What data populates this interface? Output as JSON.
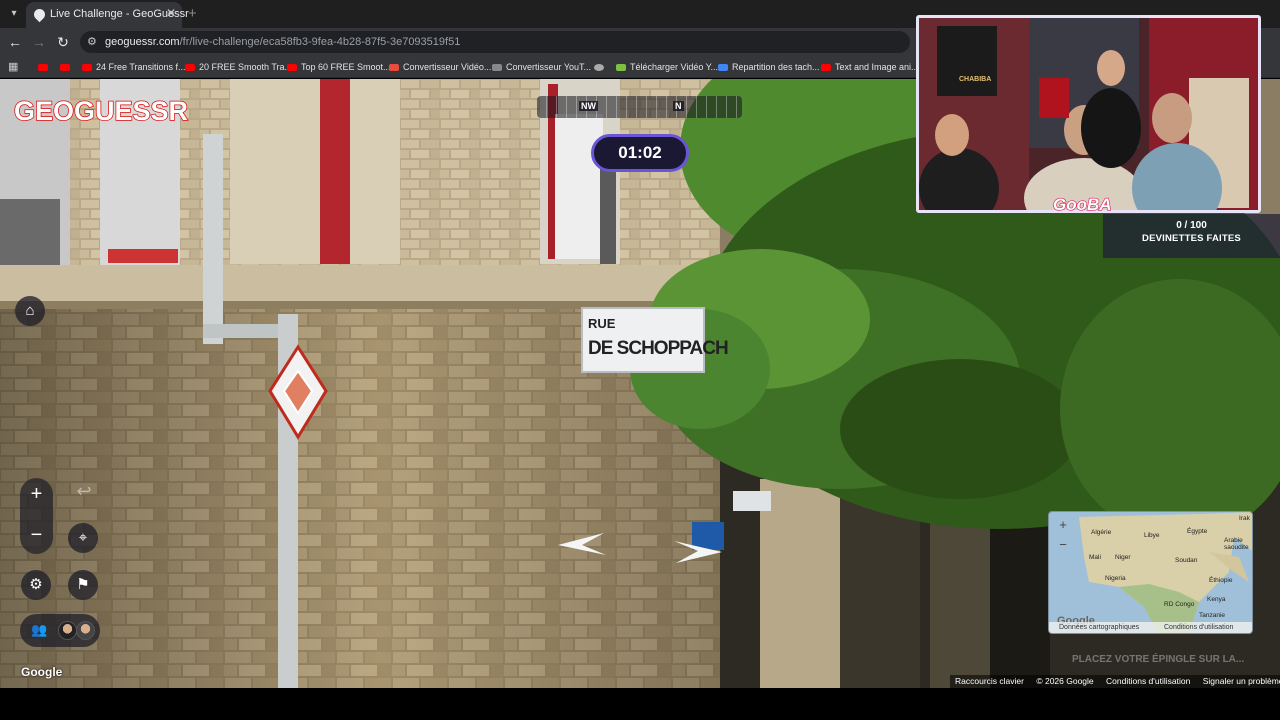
{
  "browser": {
    "tab_title": "Live Challenge - GeoGuessr",
    "url_domain": "geoguessr.com",
    "url_path": "/fr/live-challenge/eca58fb3-9fea-4b28-87f5-3e7093519f51",
    "bookmarks": [
      {
        "label": "",
        "color": "#ff0000"
      },
      {
        "label": "",
        "color": "#ff0000"
      },
      {
        "label": "24 Free Transitions f...",
        "color": "#ff0000"
      },
      {
        "label": "20 FREE Smooth Tra...",
        "color": "#ff0000"
      },
      {
        "label": "Top 60 FREE Smoot...",
        "color": "#ff0000"
      },
      {
        "label": "Convertisseur Vidéo...",
        "color": "#e74c3c"
      },
      {
        "label": "Convertisseur YouT...",
        "color": "#888888"
      },
      {
        "label": "",
        "color": "#aaaaaa"
      },
      {
        "label": "Télécharger Vidéo Y...",
        "color": "#7cc242"
      },
      {
        "label": "Repartition des tach...",
        "color": "#4285f4"
      },
      {
        "label": "Text and Image ani...",
        "color": "#ff0000"
      }
    ]
  },
  "game": {
    "logo": "GEOGUESSR",
    "compass_left": "NW",
    "compass_right": "N",
    "timer": "01:02",
    "guesses_count": "0 / 100",
    "guesses_label": "DEVINETTES FAITES",
    "pin_hint": "PLACEZ VOTRE ÉPINGLE SUR LA...",
    "google_watermark": "Google"
  },
  "scene": {
    "sign_line1": "RUE",
    "sign_line2": "DE SCHOPPACH"
  },
  "stream": {
    "overlay_text": "GooBA",
    "poster_text": "CHABIBA"
  },
  "minimap": {
    "labels": [
      "Algérie",
      "Libye",
      "Égypte",
      "Irak",
      "Arabie saoudite",
      "Mali",
      "Niger",
      "Soudan",
      "Nigeria",
      "Éthiopie",
      "RD Congo",
      "Kenya",
      "Tanzanie"
    ],
    "google": "Google",
    "footer_data": "Données cartographiques",
    "footer_terms": "Conditions d'utilisation"
  },
  "footer": {
    "shortcuts": "Raccourcis clavier",
    "copyright": "© 2026 Google",
    "terms": "Conditions d'utilisation",
    "report": "Signaler un problème"
  }
}
